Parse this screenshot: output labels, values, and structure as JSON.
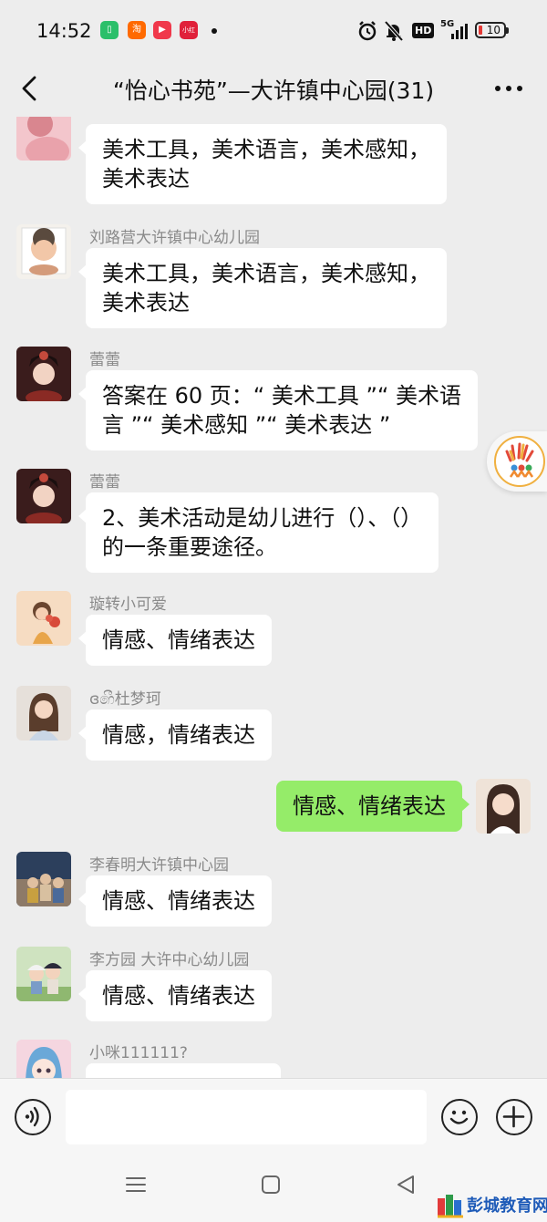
{
  "status_bar": {
    "time": "14:52",
    "apps": [
      {
        "name": "phone-app-icon",
        "color": "#2bbf6a",
        "glyph": "▯"
      },
      {
        "name": "taobao-icon",
        "color": "#ff6a00",
        "glyph": "淘"
      },
      {
        "name": "video-app-icon",
        "color": "#f0384b",
        "glyph": "▶"
      },
      {
        "name": "xiaohongshu-icon",
        "color": "#e0203a",
        "glyph": "小红书"
      }
    ],
    "network": "5G",
    "hd_label": "HD",
    "battery": "10"
  },
  "header": {
    "title": "“怡心书苑”—大许镇中心园(31)"
  },
  "messages": [
    {
      "sender": "",
      "text": "美术工具，美术语言，美术感知，\n美术表达",
      "mine": false,
      "avatar_colors": [
        "#f3c6cc",
        "#d9868f"
      ]
    },
    {
      "sender": "刘路营大许镇中心幼儿园",
      "text": "美术工具，美术语言，美术感知，\n美术表达",
      "mine": false,
      "avatar_colors": [
        "#f4f1ec",
        "#d49b7a"
      ]
    },
    {
      "sender": "蕾蕾",
      "text": "答案在 60 页：“ 美术工具 ”“ 美术语\n言 ”“ 美术感知 ”“ 美术表达 ”",
      "mine": false,
      "avatar_colors": [
        "#3a1c1c",
        "#c44a3c"
      ]
    },
    {
      "sender": "蕾蕾",
      "text": "2、美术活动是幼儿进行（）、（）\n的一条重要途径。",
      "mine": false,
      "avatar_colors": [
        "#3a1c1c",
        "#c44a3c"
      ]
    },
    {
      "sender": "璇转小可爱",
      "text": "情感、情绪表达",
      "mine": false,
      "avatar_colors": [
        "#f6dcc2",
        "#e8a54a"
      ]
    },
    {
      "sender": "ɞ෯杜梦珂",
      "text": "情感，情绪表达",
      "mine": false,
      "avatar_colors": [
        "#e6e0da",
        "#8c6a52"
      ]
    },
    {
      "sender": "",
      "text": "情感、情绪表达",
      "mine": true,
      "avatar_colors": [
        "#efe3d8",
        "#6b4a3a"
      ]
    },
    {
      "sender": "李春明大许镇中心园",
      "text": "情感、情绪表达",
      "mine": false,
      "avatar_colors": [
        "#2c3f5c",
        "#d8c0a0"
      ]
    },
    {
      "sender": "李方园 大许中心幼儿园",
      "text": "情感、情绪表达",
      "mine": false,
      "avatar_colors": [
        "#cfe3c0",
        "#7a9cc8"
      ]
    },
    {
      "sender": "小咪111111?",
      "text": "",
      "mine": false,
      "avatar_colors": [
        "#f5d6e0",
        "#6aa8d8"
      ]
    }
  ],
  "input": {
    "placeholder": ""
  },
  "watermark": {
    "text": "彭城教育网"
  },
  "colors": {
    "background": "#ededed",
    "my_bubble": "#95ec69",
    "their_bubble": "#ffffff",
    "sender_name": "#8a8a8a"
  }
}
